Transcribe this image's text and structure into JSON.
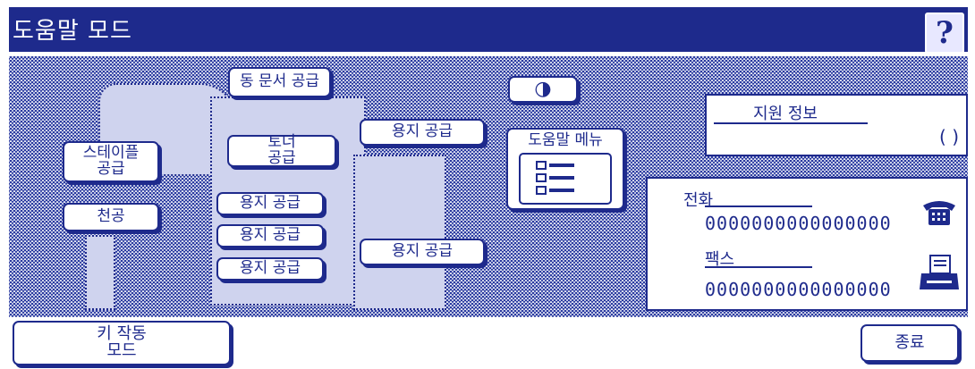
{
  "window": {
    "title": "도움말 모드",
    "help_glyph": "?"
  },
  "buttons": {
    "auto_doc_feed": "동 문서 공급",
    "paper_feed_1": "용지 공급",
    "toner_line1": "토너",
    "toner_line2": "공급",
    "staple_line1": "스테이플",
    "staple_line2": "공급",
    "punch": "천공",
    "tray_1": "용지 공급",
    "tray_2": "용지 공급",
    "tray_3": "용지 공급",
    "lct": "용지 공급",
    "contrast_icon": "◑",
    "help_menu": "도움말 메뉴",
    "key_op_line1": "키 작동",
    "key_op_line2": "모드",
    "exit": "종료"
  },
  "support": {
    "label": "지원 정보",
    "value": "(      )"
  },
  "contact": {
    "phone_label": "전화",
    "phone_number": "0000000000000000",
    "fax_label": "팩스",
    "fax_number": "0000000000000000"
  },
  "colors": {
    "primary": "#1e2a8c",
    "panel_hatch": "#2a3aa0",
    "background": "#ffffff"
  }
}
